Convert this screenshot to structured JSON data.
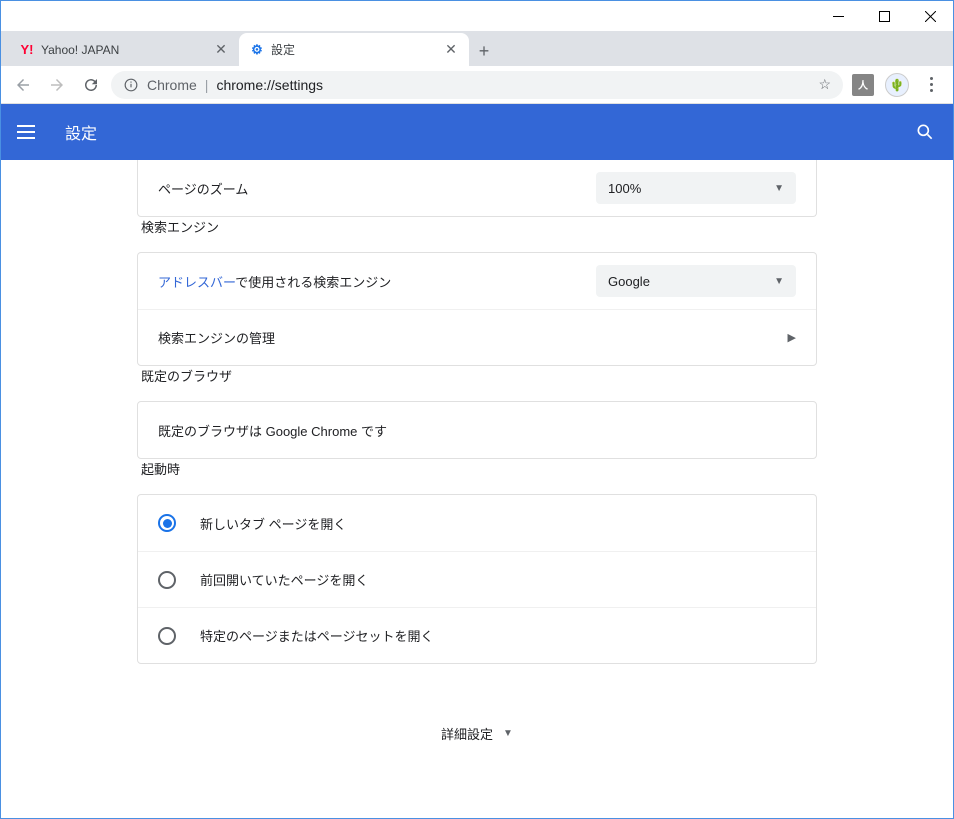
{
  "window": {
    "tabs": [
      {
        "title": "Yahoo! JAPAN",
        "favicon": "Y!",
        "favicon_color": "#ff0033",
        "active": false
      },
      {
        "title": "設定",
        "favicon": "⚙",
        "favicon_color": "#1a73e8",
        "active": true
      }
    ]
  },
  "omnibar": {
    "chrome_label": "Chrome",
    "url_text": "chrome://settings"
  },
  "header": {
    "title": "設定"
  },
  "page_zoom": {
    "label": "ページのズーム",
    "value": "100%"
  },
  "sections": {
    "search_engine": {
      "title": "検索エンジン",
      "addressbar_link": "アドレスバー",
      "addressbar_rest": "で使用される検索エンジン",
      "engine_value": "Google",
      "manage_label": "検索エンジンの管理"
    },
    "default_browser": {
      "title": "既定のブラウザ",
      "message": "既定のブラウザは Google Chrome です"
    },
    "on_startup": {
      "title": "起動時",
      "options": [
        {
          "label": "新しいタブ ページを開く",
          "checked": true
        },
        {
          "label": "前回開いていたページを開く",
          "checked": false
        },
        {
          "label": "特定のページまたはページセットを開く",
          "checked": false
        }
      ]
    }
  },
  "advanced_label": "詳細設定"
}
